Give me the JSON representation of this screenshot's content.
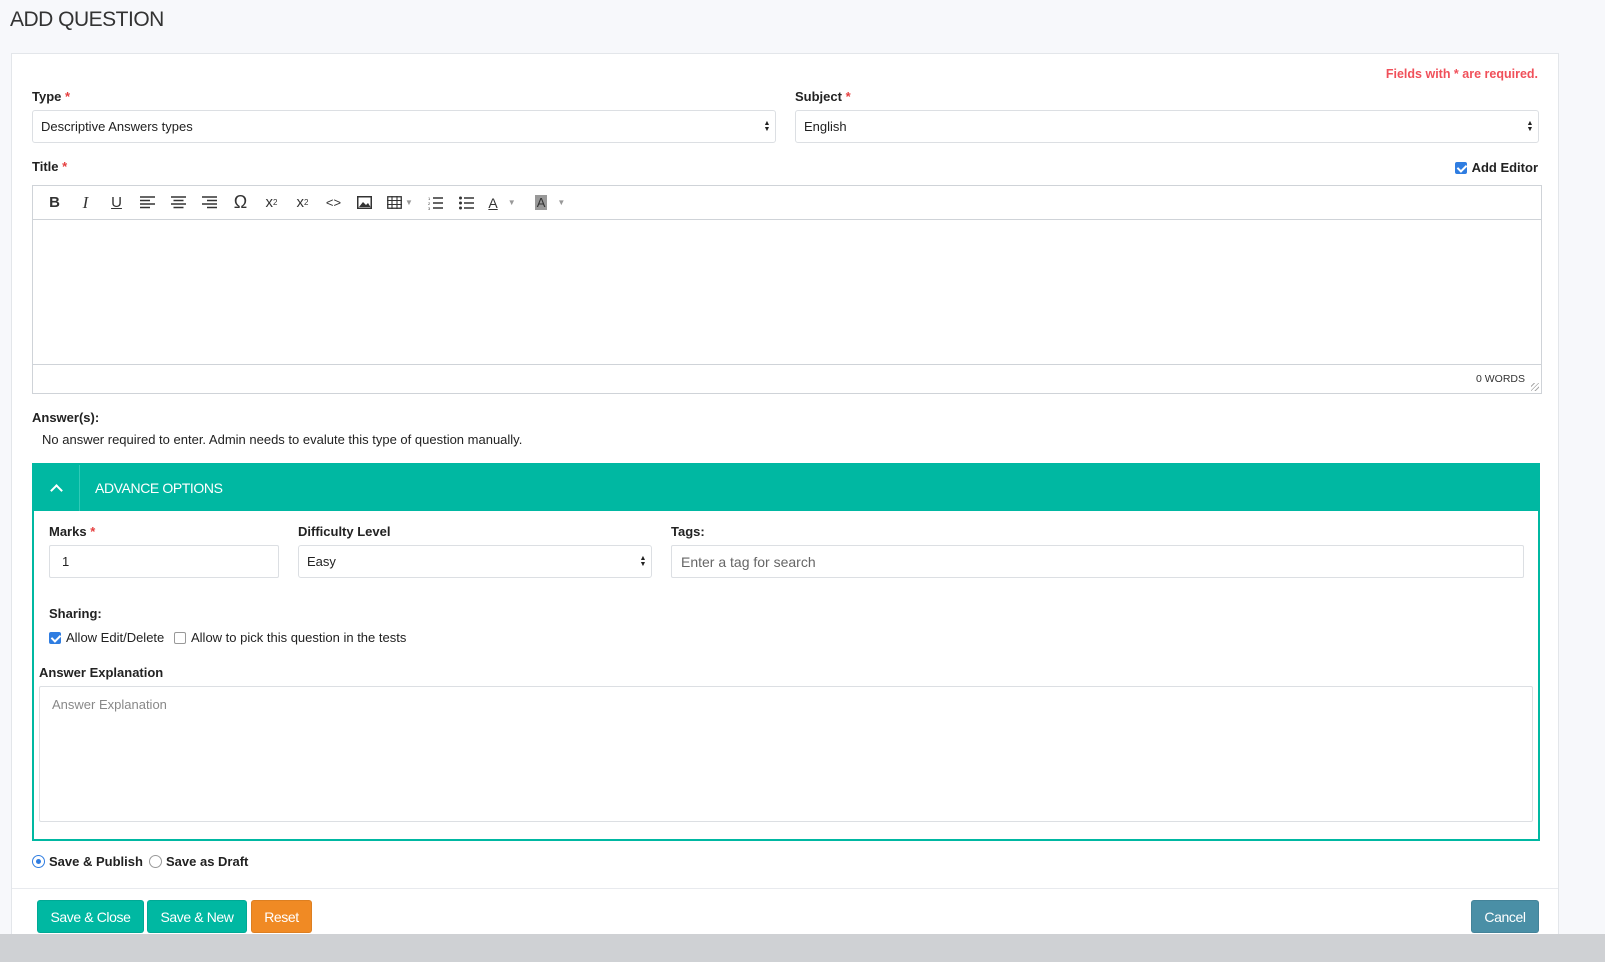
{
  "page": {
    "title": "ADD QUESTION"
  },
  "form": {
    "required_note": "Fields with * are required.",
    "type": {
      "label": "Type",
      "star": "*",
      "value": "Descriptive Answers types"
    },
    "subject": {
      "label": "Subject",
      "star": "*",
      "value": "English"
    },
    "title": {
      "label": "Title",
      "star": "*"
    },
    "add_editor": {
      "label": "Add Editor",
      "checked": true
    },
    "editor": {
      "toolbar": [
        "bold",
        "italic",
        "underline",
        "align-left",
        "align-center",
        "align-right",
        "special-character",
        "subscript",
        "superscript",
        "source-code",
        "image",
        "table",
        "numbered-list",
        "bulleted-list",
        "text-color",
        "background-color"
      ],
      "word_count": "0 WORDS"
    },
    "answers": {
      "label": "Answer(s):",
      "note": "No answer required to enter. Admin needs to evalute this type of question manually."
    },
    "advance_options": {
      "title": "ADVANCE OPTIONS",
      "marks": {
        "label": "Marks",
        "star": "*",
        "value": "1"
      },
      "difficulty": {
        "label": "Difficulty Level",
        "value": "Easy"
      },
      "tags": {
        "label": "Tags:",
        "placeholder": "Enter a tag for search"
      },
      "sharing": {
        "label": "Sharing:",
        "allow_edit": {
          "label": "Allow Edit/Delete",
          "checked": true
        },
        "allow_pick": {
          "label": "Allow to pick this question in the tests",
          "checked": false
        }
      },
      "explanation": {
        "label": "Answer Explanation",
        "placeholder": "Answer Explanation"
      }
    },
    "publish": {
      "save_publish": {
        "label": "Save & Publish",
        "checked": true
      },
      "save_draft": {
        "label": "Save as Draft",
        "checked": false
      }
    },
    "buttons": {
      "save_close": "Save & Close",
      "save_new": "Save & New",
      "reset": "Reset",
      "cancel": "Cancel"
    }
  },
  "colors": {
    "accent": "#00b8a2",
    "danger": "#f0505a",
    "reset": "#f08a24",
    "cancel": "#4a8fa6"
  }
}
